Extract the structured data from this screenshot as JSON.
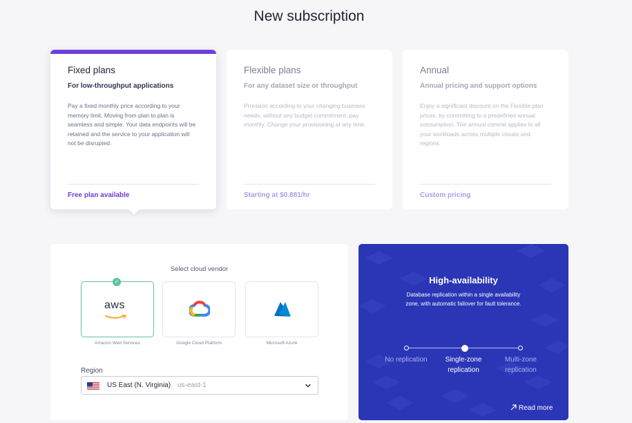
{
  "page": {
    "title": "New subscription"
  },
  "plans": [
    {
      "title": "Fixed plans",
      "subtitle": "For low-throughput applications",
      "description": "Pay a fixed monthly price according to your memory limit. Moving from plan to plan is seamless and simple. Your data endpoints will be retained and the service to your application will not be disrupted.",
      "footer": "Free plan available",
      "selected": true
    },
    {
      "title": "Flexible plans",
      "subtitle": "For any dataset size or throughput",
      "description": "Provision according to your changing business needs, without any budget commitment, pay monthly. Change your provisioning at any time.",
      "footer": "Starting at $0.881/hr",
      "selected": false
    },
    {
      "title": "Annual",
      "subtitle": "Annual pricing and support options",
      "description": "Enjoy a significant discount on the Flexible plan prices, by committing to a predefined annual consumption. The annual commit applies to all your workloads across multiple clouds and regions.",
      "footer": "Custom pricing",
      "selected": false
    }
  ],
  "vendor": {
    "label": "Select cloud vendor",
    "options": [
      {
        "name": "Amazon Web Services",
        "logo_text": "aws",
        "icon": "aws-logo-icon",
        "selected": true
      },
      {
        "name": "Google Cloud Platform",
        "icon": "google-cloud-logo-icon",
        "selected": false
      },
      {
        "name": "Microsoft Azure",
        "icon": "azure-logo-icon",
        "selected": false
      }
    ]
  },
  "region": {
    "label": "Region",
    "name": "US East (N. Virginia)",
    "code": "us-east-1",
    "flag_icon": "us-flag-icon"
  },
  "availability": {
    "title": "High-availability",
    "description": "Database replication within a single availability zone, with automatic failover for fault tolerance.",
    "options": [
      {
        "label_line1": "No replication",
        "label_line2": "",
        "active": false
      },
      {
        "label_line1": "Single-zone",
        "label_line2": "replication",
        "active": true
      },
      {
        "label_line1": "Multi-zone",
        "label_line2": "replication",
        "active": false
      }
    ],
    "read_more": "Read more"
  },
  "colors": {
    "accent": "#6e3fdb",
    "selected_vendor": "#5bc59c",
    "panel_blue": "#2a36b6"
  }
}
